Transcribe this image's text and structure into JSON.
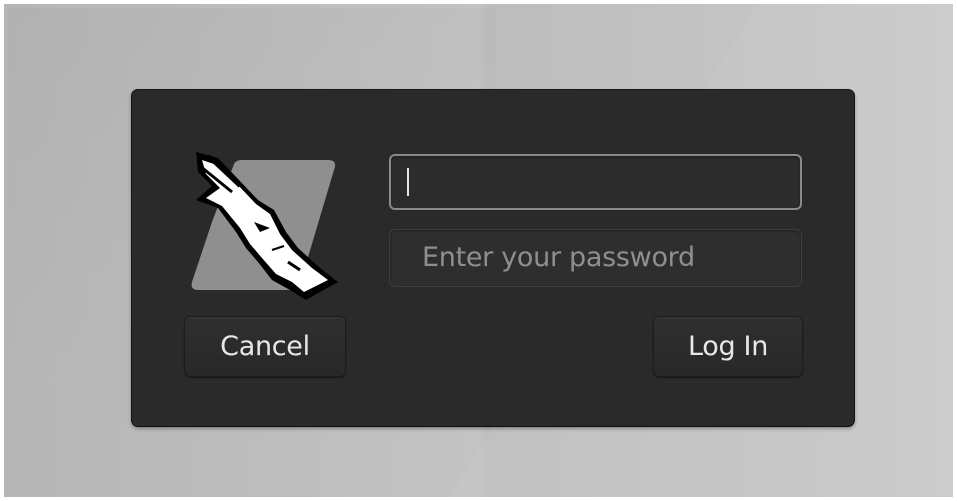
{
  "login_dialog": {
    "password_placeholder": "Enter your password",
    "cancel_label": "Cancel",
    "login_label": "Log In"
  },
  "icons": {
    "logo": "kali-dragon-logo-icon"
  },
  "colors": {
    "dialog_background": "#2a2a2a",
    "desktop_background": "#bdbdbd",
    "text": "#e8e8e8",
    "placeholder": "#8f8f8f"
  }
}
